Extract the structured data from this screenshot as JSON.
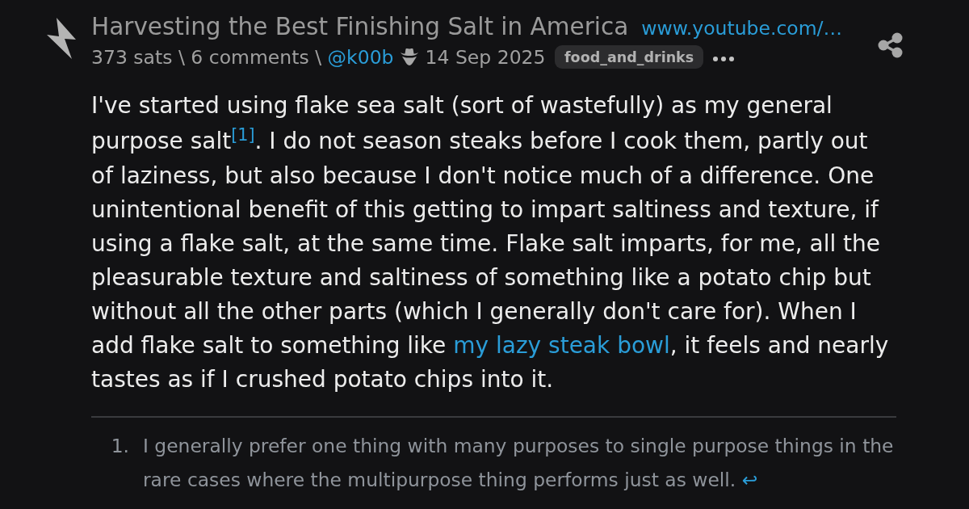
{
  "post": {
    "title": "Harvesting the Best Finishing Salt in America",
    "link": "www.youtube.com/…",
    "meta": [
      {
        "kind": "text",
        "text": "373 sats"
      },
      {
        "kind": "separator",
        "text": "\\"
      },
      {
        "kind": "link",
        "text": "6 comments"
      },
      {
        "kind": "separator",
        "text": "\\"
      },
      {
        "kind": "user",
        "text": "@k00b"
      },
      {
        "kind": "date",
        "text": "14 Sep 2025"
      }
    ],
    "tag": "food_and_drinks"
  },
  "body": {
    "segments": [
      {
        "kind": "text",
        "text": "I've started using flake sea salt (sort of wastefully) as my general purpose salt"
      },
      {
        "kind": "footnote_ref",
        "text": "[1]"
      },
      {
        "kind": "text",
        "text": ". I do not season steaks before I cook them, partly out of laziness, but also because I don't notice much of a difference. One unintentional benefit of this getting to impart saltiness and texture, if using a flake salt, at the same time. Flake salt imparts, for me, all the pleasurable texture and saltiness of something like a potato chip but without all the other parts (which I generally don't care for). When I add flake salt to something like "
      },
      {
        "kind": "link",
        "text": "my lazy steak bowl"
      },
      {
        "kind": "text",
        "text": ", it feels and nearly tastes as if I crushed potato chips into it."
      }
    ]
  },
  "footnotes": [
    {
      "number": "1.",
      "text": "I generally prefer one thing with many purposes to single purpose things in the rare cases where the multipurpose thing performs just as well.",
      "backref": "↩"
    }
  ]
}
